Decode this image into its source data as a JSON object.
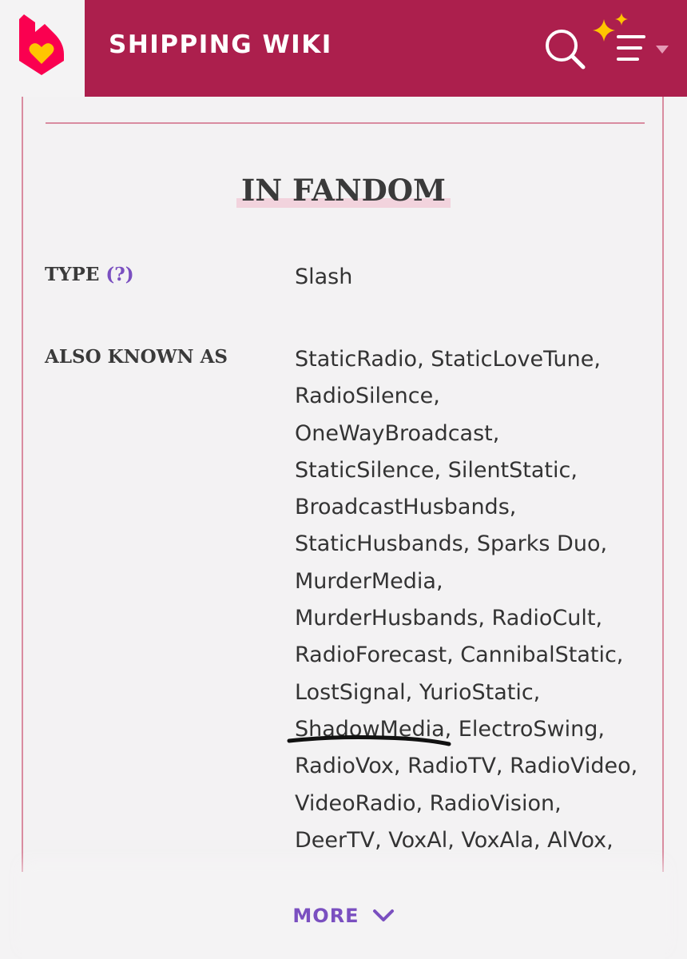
{
  "header": {
    "wiki_title": "SHIPPING WIKI",
    "logo_icon": "fandom-flame-heart-icon",
    "search_icon": "search-icon",
    "menu_icon": "hamburger-menu-icon",
    "sparkle_icon": "sparkle-icon",
    "dropdown_icon": "caret-down-icon",
    "brand_color": "#ac1f4d"
  },
  "infobox": {
    "section_title": "IN FANDOM",
    "type_label": "TYPE",
    "type_help": "(?)",
    "type_value": "Slash",
    "aka_label": "ALSO KNOWN AS",
    "aka_lines": [
      "StaticRadio, StaticLoveTune,",
      "RadioSilence,",
      "OneWayBroadcast,",
      "StaticSilence, SilentStatic,",
      "BroadcastHusbands,",
      "StaticHusbands, Sparks Duo,",
      "MurderMedia,",
      "MurderHusbands, RadioCult,",
      "RadioForecast, CannibalStatic,",
      "LostSignal, YurioStatic,",
      "ShadowMedia, ElectroSwing,",
      "RadioVox, RadioTV, RadioVideo,",
      "VideoRadio, RadioVision,",
      "DeerTV, VoxAl, VoxAla, AlVox,"
    ]
  },
  "footer": {
    "more_label": "MORE",
    "more_icon": "chevron-down-icon",
    "accent_color": "#7a4fc0"
  }
}
